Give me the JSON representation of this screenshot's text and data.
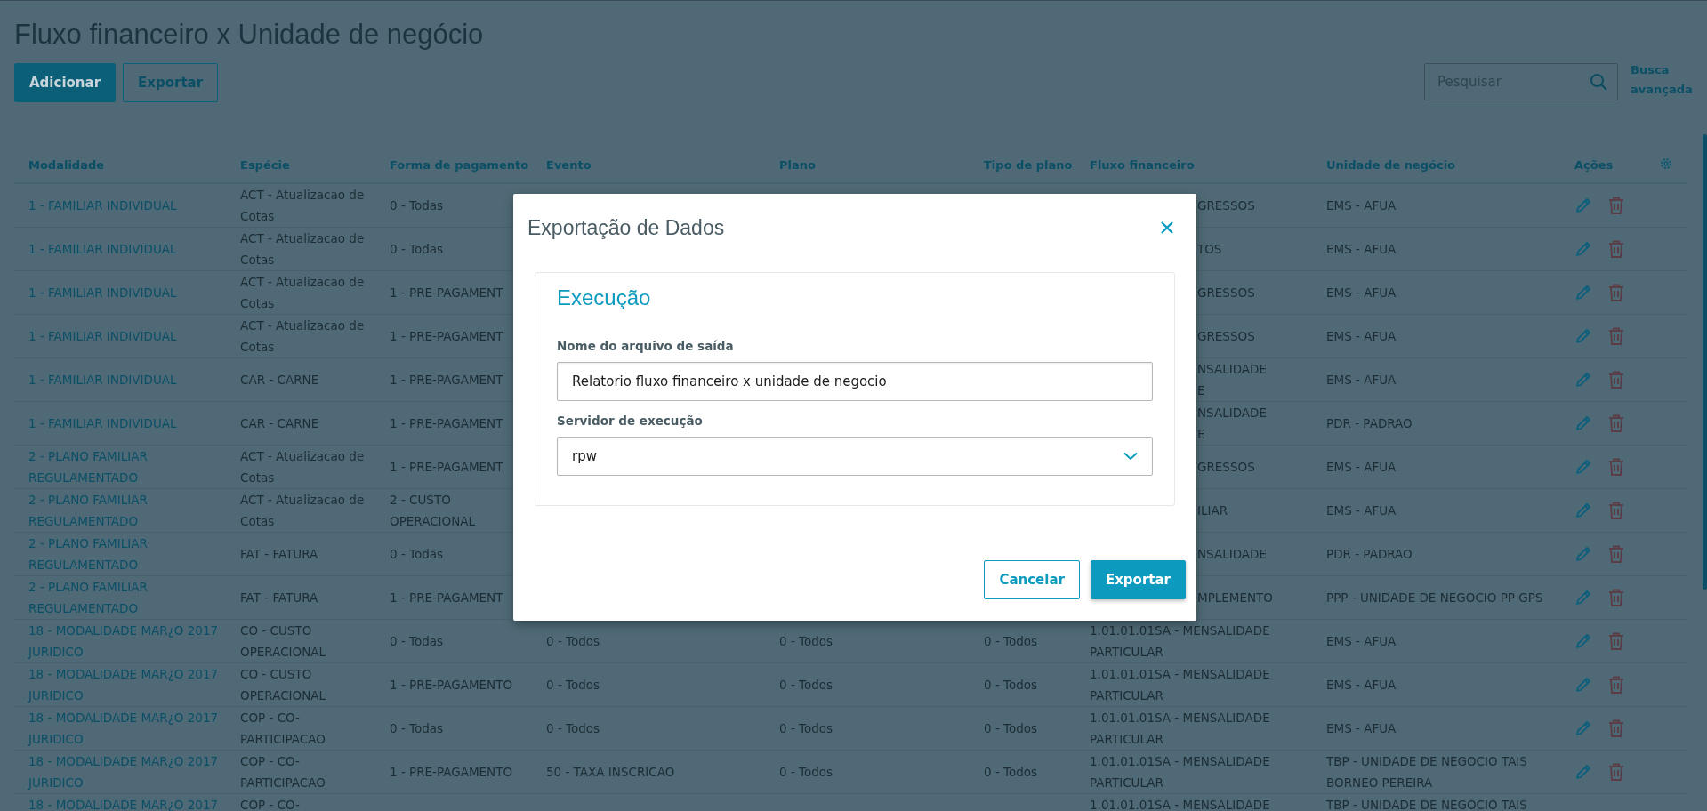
{
  "page": {
    "title": "Fluxo financeiro x Unidade de negócio",
    "buttons": [
      {
        "label": "Adicionar",
        "kind": "primary"
      },
      {
        "label": "Exportar",
        "kind": "secondary"
      }
    ],
    "search": {
      "placeholder": "Pesquisar"
    },
    "advanced_search": "Busca avançada"
  },
  "table": {
    "columns": [
      "Modalidade",
      "Espécie",
      "Forma de pagamento",
      "Evento",
      "Plano",
      "Tipo de plano",
      "Fluxo financeiro",
      "Unidade de negócio",
      "Ações"
    ],
    "rows": [
      {
        "modalidade": "1 - FAMILIAR INDIVIDUAL",
        "especie": "ACT - Atualizacao de Cotas",
        "forma": "0 - Todas",
        "fluxo": "GRESSOS",
        "unidade": "EMS - AFUA",
        "under_dialog": true,
        "actions": true
      },
      {
        "modalidade": "1 - FAMILIAR INDIVIDUAL",
        "especie": "ACT - Atualizacao de Cotas",
        "forma": "0 - Todas",
        "fluxo": "TOS",
        "unidade": "EMS - AFUA",
        "under_dialog": true,
        "actions": true
      },
      {
        "modalidade": "1 - FAMILIAR INDIVIDUAL",
        "especie": "ACT - Atualizacao de Cotas",
        "forma": "1 - PRE-PAGAMENT",
        "fluxo": "GRESSOS",
        "unidade": "EMS - AFUA",
        "under_dialog": true,
        "actions": true
      },
      {
        "modalidade": "1 - FAMILIAR INDIVIDUAL",
        "especie": "ACT - Atualizacao de Cotas",
        "forma": "1 - PRE-PAGAMENT",
        "fluxo": "GRESSOS",
        "unidade": "EMS - AFUA",
        "under_dialog": true,
        "actions": true
      },
      {
        "modalidade": "1 - FAMILIAR INDIVIDUAL",
        "especie": "CAR - CARNE",
        "forma": "1 - PRE-PAGAMENT",
        "fluxo": "NSALIDADE\nE",
        "unidade": "EMS - AFUA",
        "under_dialog": true,
        "actions": true
      },
      {
        "modalidade": "1 - FAMILIAR INDIVIDUAL",
        "especie": "CAR - CARNE",
        "forma": "1 - PRE-PAGAMENT",
        "fluxo": "NSALIDADE\nE",
        "unidade": "PDR - PADRAO",
        "under_dialog": true,
        "actions": true
      },
      {
        "modalidade": "2 - PLANO FAMILIAR REGULAMENTADO",
        "especie": "ACT - Atualizacao de Cotas",
        "forma": "1 - PRE-PAGAMENT",
        "fluxo": "GRESSOS",
        "unidade": "EMS - AFUA",
        "under_dialog": true,
        "actions": true
      },
      {
        "modalidade": "2 - PLANO FAMILIAR REGULAMENTADO",
        "especie": "ACT - Atualizacao de Cotas",
        "forma": "2 - CUSTO OPERACIONAL",
        "fluxo": "ILIAR",
        "unidade": "EMS - AFUA",
        "under_dialog": true,
        "actions": true
      },
      {
        "modalidade": "2 - PLANO FAMILIAR REGULAMENTADO",
        "especie": "FAT - FATURA",
        "forma": "0 - Todas",
        "fluxo": "NSALIDADE",
        "unidade": "PDR - PADRAO",
        "under_dialog": true,
        "actions": true
      },
      {
        "modalidade": "2 - PLANO FAMILIAR REGULAMENTADO",
        "especie": "FAT - FATURA",
        "forma": "1 - PRE-PAGAMENT",
        "fluxo": "MPLEMENTO",
        "unidade": "PPP - UNIDADE DE NEGOCIO PP GPS",
        "under_dialog": true,
        "actions": true
      },
      {
        "modalidade": "18 - MODALIDADE MAR¿O 2017 JURIDICO",
        "especie": "CO - CUSTO OPERACIONAL",
        "forma": "0 - Todas",
        "evento": "0 - Todos",
        "plano": "0 - Todos",
        "tipo": "0 - Todos",
        "fluxo": "1.01.01.01SA - MENSALIDADE PARTICULAR",
        "unidade": "EMS - AFUA",
        "under_dialog": false,
        "actions": true
      },
      {
        "modalidade": "18 - MODALIDADE MAR¿O 2017 JURIDICO",
        "especie": "CO - CUSTO OPERACIONAL",
        "forma": "1 - PRE-PAGAMENTO",
        "evento": "0 - Todos",
        "plano": "0 - Todos",
        "tipo": "0 - Todos",
        "fluxo": "1.01.01.01SA - MENSALIDADE PARTICULAR",
        "unidade": "EMS - AFUA",
        "under_dialog": false,
        "actions": true
      },
      {
        "modalidade": "18 - MODALIDADE MAR¿O 2017 JURIDICO",
        "especie": "COP - CO-PARTICIPACAO",
        "forma": "0 - Todas",
        "evento": "0 - Todos",
        "plano": "0 - Todos",
        "tipo": "0 - Todos",
        "fluxo": "1.01.01.01SA - MENSALIDADE PARTICULAR",
        "unidade": "EMS - AFUA",
        "under_dialog": false,
        "actions": true
      },
      {
        "modalidade": "18 - MODALIDADE MAR¿O 2017 JURIDICO",
        "especie": "COP - CO-PARTICIPACAO",
        "forma": "1 - PRE-PAGAMENTO",
        "evento": "50 - TAXA INSCRICAO",
        "plano": "0 - Todos",
        "tipo": "0 - Todos",
        "fluxo": "1.01.01.01SA - MENSALIDADE PARTICULAR",
        "unidade": "TBP - UNIDADE DE NEGOCIO TAIS BORNEO PEREIRA",
        "under_dialog": false,
        "actions": true
      },
      {
        "modalidade": "18 - MODALIDADE MAR¿O 2017",
        "especie": "COP - CO-",
        "fluxo": "1.01.01.01SA - MENSALIDADE",
        "unidade": "TBP - UNIDADE DE NEGOCIO TAIS",
        "under_dialog": false,
        "actions": false
      }
    ]
  },
  "dialog": {
    "title": "Exportação de Dados",
    "section": "Execução",
    "fields": [
      {
        "label": "Nome do arquivo de saída",
        "value": "Relatorio fluxo financeiro x unidade de negocio",
        "kind": "text"
      },
      {
        "label": "Servidor de execução",
        "value": "rpw",
        "kind": "select"
      }
    ],
    "buttons": [
      {
        "label": "Cancelar",
        "kind": "secondary"
      },
      {
        "label": "Exportar",
        "kind": "primary"
      }
    ]
  }
}
